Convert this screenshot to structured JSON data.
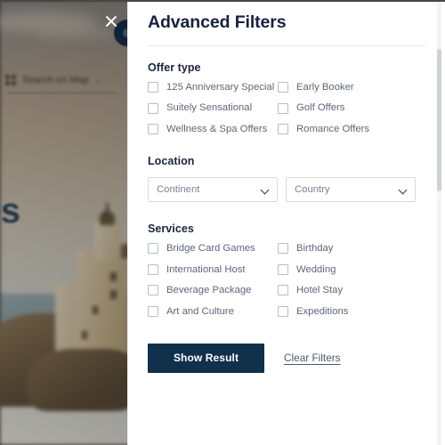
{
  "background": {
    "hero_title_fragment": "es",
    "map_search": {
      "icon": "map-grid-icon",
      "label": "Search on Map",
      "chevron": "⌄"
    },
    "close_icon": "close-icon",
    "badge": "dark-circle-badge"
  },
  "panel": {
    "title": "Advanced Filters",
    "sections": {
      "offer_type": {
        "heading": "Offer type",
        "options": [
          "125 Anniversary Special",
          "Early Booker",
          "Suitely Sensational",
          "Golf Offers",
          "Wellness & Spa Offers",
          "Romance Offers"
        ]
      },
      "location": {
        "heading": "Location",
        "selects": [
          {
            "name": "continent",
            "value": "Continent"
          },
          {
            "name": "country",
            "value": "Country"
          }
        ]
      },
      "services": {
        "heading": "Services",
        "options": [
          "Bridge Card Games",
          "Birthday",
          "International Host",
          "Wedding",
          "Beverage Package",
          "Hotel Stay",
          "Art and Culture",
          "Expeditions"
        ]
      }
    },
    "footer": {
      "primary_label": "Show Result",
      "clear_label": "Clear Filters"
    }
  },
  "colors": {
    "accent_navy": "#10304c",
    "title_navy": "#16213e",
    "label_gray": "#5d6677",
    "border_gray": "#d8dade"
  }
}
